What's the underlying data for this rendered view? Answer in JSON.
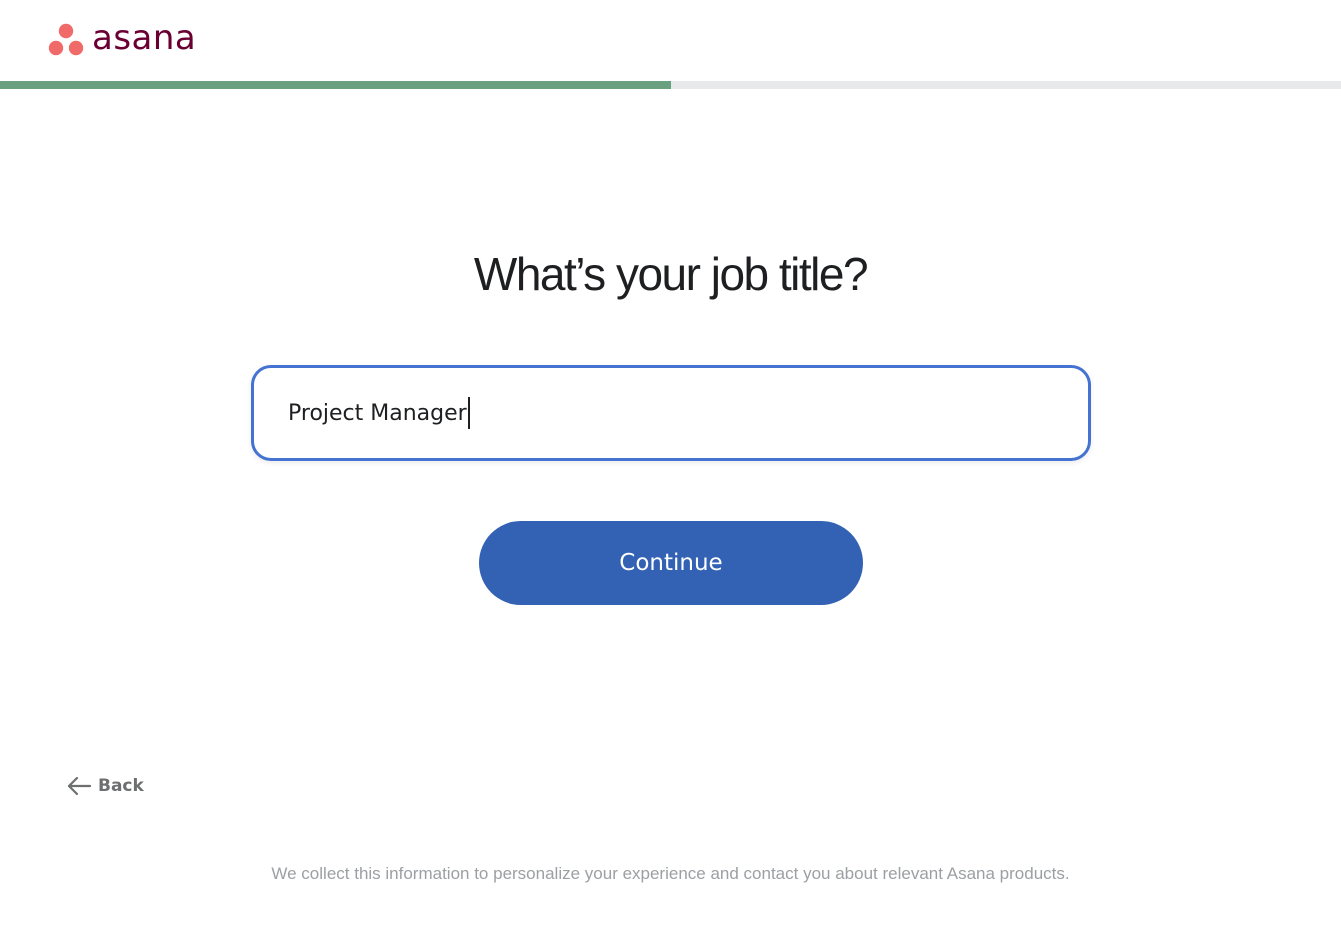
{
  "app": {
    "brand_name": "asana",
    "brand_color": "#690031",
    "logo_dot_color": "#f06a6a"
  },
  "progress": {
    "fraction": 0.5,
    "fill_color": "#6aa080",
    "track_color": "#e8e9ea"
  },
  "main": {
    "title": "What’s your job title?",
    "job_input": {
      "value": "Project Manager",
      "border_color": "#4573d2"
    },
    "continue_label": "Continue",
    "continue_color": "#3361b4"
  },
  "nav": {
    "back_label": "Back",
    "back_icon": "arrow-left-icon"
  },
  "footer": {
    "note": "We collect this information to personalize your experience and contact you about relevant Asana products."
  }
}
